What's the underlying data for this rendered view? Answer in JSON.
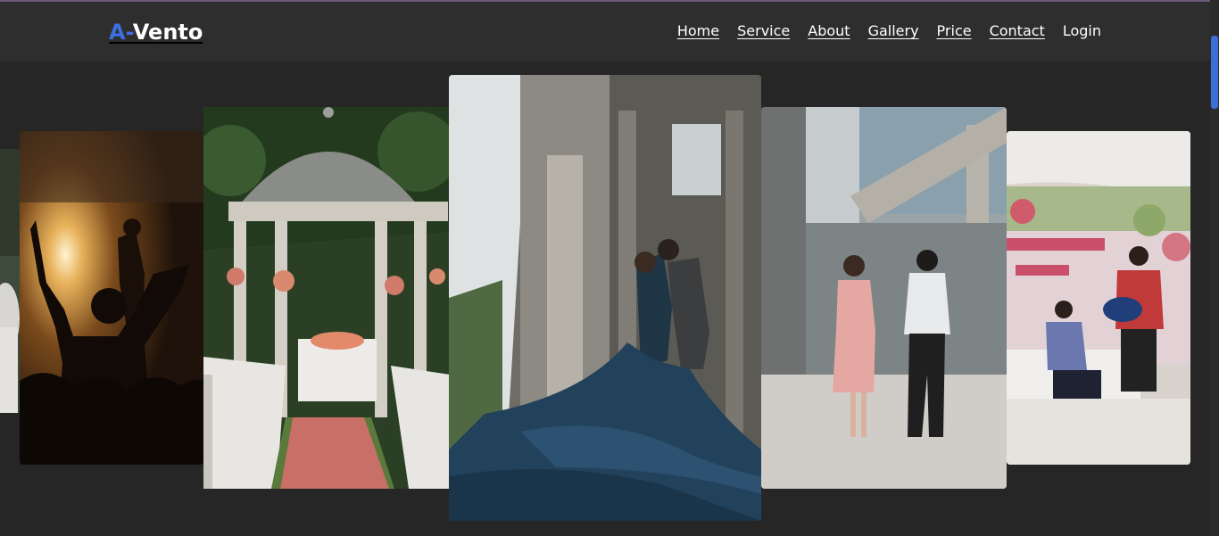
{
  "brand": {
    "part1": "A-",
    "part2": "Vento"
  },
  "nav": {
    "home": "Home",
    "service": "Service",
    "about": "About",
    "gallery": "Gallery",
    "price": "Price",
    "contact": "Contact",
    "login": "Login"
  },
  "carousel": {
    "slides": [
      {
        "name": "bride-photo"
      },
      {
        "name": "concert-photo"
      },
      {
        "name": "gazebo-wedding-photo"
      },
      {
        "name": "couple-blue-gown-photo"
      },
      {
        "name": "couple-walking-photo"
      },
      {
        "name": "anniversary-band-photo"
      }
    ]
  },
  "colors": {
    "accent": "#3d6fe0",
    "navbar": "#2e2e2e",
    "background": "#262626"
  }
}
